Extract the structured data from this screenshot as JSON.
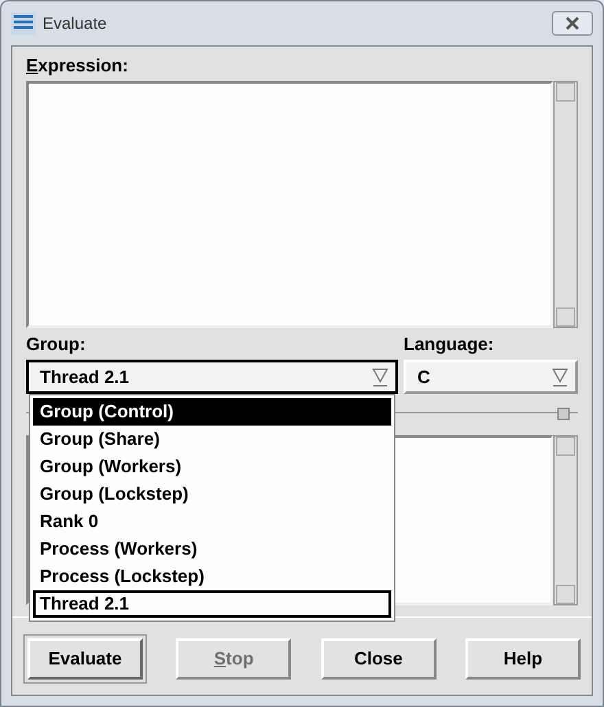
{
  "window": {
    "title": "Evaluate"
  },
  "expression": {
    "label_mnemonic": "E",
    "label_rest": "xpression:"
  },
  "group": {
    "label": "Group:",
    "value": "Thread 2.1",
    "open": true,
    "options": [
      {
        "label": "Group (Control)",
        "highlighted": true,
        "selected": false
      },
      {
        "label": "Group (Share)",
        "highlighted": false,
        "selected": false
      },
      {
        "label": "Group (Workers)",
        "highlighted": false,
        "selected": false
      },
      {
        "label": "Group (Lockstep)",
        "highlighted": false,
        "selected": false
      },
      {
        "label": "Rank 0",
        "highlighted": false,
        "selected": false
      },
      {
        "label": "Process (Workers)",
        "highlighted": false,
        "selected": false
      },
      {
        "label": "Process (Lockstep)",
        "highlighted": false,
        "selected": false
      },
      {
        "label": "Thread 2.1",
        "highlighted": false,
        "selected": true
      }
    ]
  },
  "language": {
    "label": "Language:",
    "value": "C"
  },
  "buttons": [
    {
      "label": "Evaluate",
      "default": true,
      "disabled": false
    },
    {
      "label": "top",
      "mnemonic": "S",
      "default": false,
      "disabled": true
    },
    {
      "label": "Close",
      "default": false,
      "disabled": false
    },
    {
      "label": "Help",
      "default": false,
      "disabled": false
    }
  ]
}
